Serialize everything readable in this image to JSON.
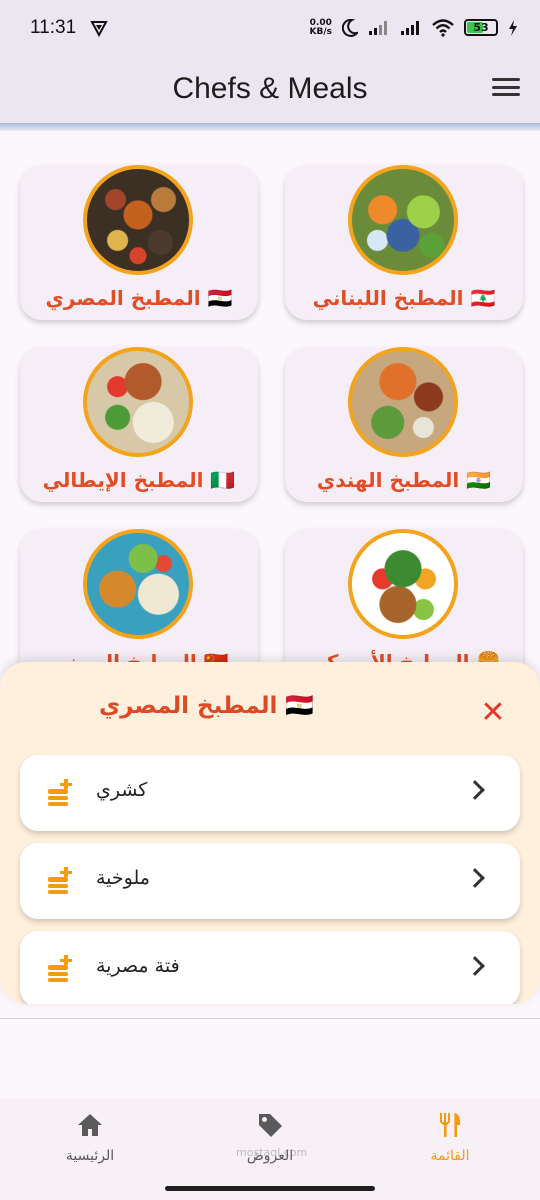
{
  "status_bar": {
    "time": "11:31",
    "net_speed_value": "0.00",
    "net_speed_unit": "KB/s",
    "battery_level": "53"
  },
  "app_bar": {
    "title": "Chefs & Meals",
    "menu_icon": "hamburger-menu-icon"
  },
  "cuisines": [
    {
      "label": "🇱🇧 المطبخ اللبناني",
      "image": "lebanese-food"
    },
    {
      "label": "🇪🇬 المطبخ المصري",
      "image": "egyptian-food"
    },
    {
      "label": "🇮🇳 المطبخ الهندي",
      "image": "indian-food"
    },
    {
      "label": "🇮🇹 المطبخ الإيطالي",
      "image": "italian-food"
    },
    {
      "label": "🍔 المطبخ الأمريكي",
      "image": "vegetable-basket"
    },
    {
      "label": "🇨🇳 المطبخ الصيني",
      "image": "mixed-plate"
    }
  ],
  "sheet": {
    "title": "🇪🇬 المطبخ المصري",
    "close_icon": "close-icon",
    "meals": [
      {
        "name": "كشري"
      },
      {
        "name": "ملوخية"
      },
      {
        "name": "فتة مصرية"
      }
    ]
  },
  "bottom_nav": {
    "items": [
      {
        "label": "القائمة",
        "icon": "restaurant-icon",
        "active": true
      },
      {
        "label": "العروض",
        "icon": "tag-icon",
        "active": false
      },
      {
        "label": "الرئيسية",
        "icon": "home-icon",
        "active": false
      }
    ]
  },
  "watermark": "mostaql.com",
  "colors": {
    "accent": "#f39c12",
    "label_red": "#e24d25",
    "sheet_bg": "#fff0dd",
    "appbar_bg": "#ece6f1"
  }
}
